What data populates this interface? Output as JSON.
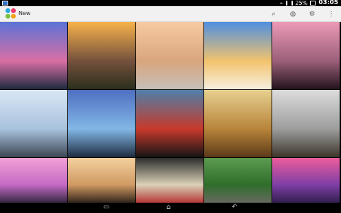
{
  "status_bar": {
    "battery": "25%",
    "time": "03:05",
    "icons": [
      "notification-icon",
      "wifi-icon",
      "signal-icon",
      "battery-icon"
    ]
  },
  "action_bar": {
    "title": "New",
    "icons": [
      "search-icon",
      "palette-icon",
      "settings-icon",
      "overflow-menu-icon"
    ]
  },
  "navigation_bar": {
    "icons": [
      "recent-apps-icon",
      "home-icon",
      "back-icon"
    ]
  },
  "grid": [
    {
      "name": "lake-sunset-wallpaper",
      "colors": [
        "#5b73d6",
        "#d96fa4",
        "#1e2a40"
      ]
    },
    {
      "name": "boardwalk-sunrise-wallpaper",
      "colors": [
        "#f7b24a",
        "#74513d",
        "#2a2f1c"
      ]
    },
    {
      "name": "misty-field-wallpaper",
      "colors": [
        "#f8cba2",
        "#d8a57e",
        "#c6c0b8"
      ]
    },
    {
      "name": "beach-palm-wallpaper",
      "colors": [
        "#4f8fe0",
        "#f3c36d",
        "#f6efe0"
      ]
    },
    {
      "name": "rocky-coast-wallpaper",
      "colors": [
        "#ec9ab7",
        "#9b5f79",
        "#22131b"
      ]
    },
    {
      "name": "volcano-snow-wallpaper",
      "colors": [
        "#d9e7f5",
        "#a8c2dc",
        "#3c4553"
      ]
    },
    {
      "name": "stormy-beach-wallpaper",
      "colors": [
        "#4f6fc2",
        "#82b7e6",
        "#1d2b3e"
      ]
    },
    {
      "name": "red-car-wallpaper",
      "colors": [
        "#4e80a9",
        "#c7392b",
        "#141414"
      ]
    },
    {
      "name": "wheat-field-wallpaper",
      "colors": [
        "#e7d08f",
        "#b7843a",
        "#5b3a18"
      ]
    },
    {
      "name": "vintage-cars-wallpaper",
      "colors": [
        "#dcdcdc",
        "#9d9d9d",
        "#3c352a"
      ]
    },
    {
      "name": "pink-sunset-wallpaper",
      "colors": [
        "#f3a0d6",
        "#c46ac4",
        "#2b2238"
      ]
    },
    {
      "name": "tree-sunset-wallpaper",
      "colors": [
        "#f3d09d",
        "#d09a63",
        "#261d16"
      ]
    },
    {
      "name": "classic-car-wallpaper",
      "colors": [
        "#2d2d2d",
        "#d9d1b7",
        "#b32d2d"
      ]
    },
    {
      "name": "castle-forest-wallpaper",
      "colors": [
        "#5c9b4f",
        "#2f6d2b",
        "#6b6a62"
      ]
    },
    {
      "name": "purple-lake-wallpaper",
      "colors": [
        "#ec5d9c",
        "#7e3fa5",
        "#2c1c4a"
      ]
    }
  ]
}
